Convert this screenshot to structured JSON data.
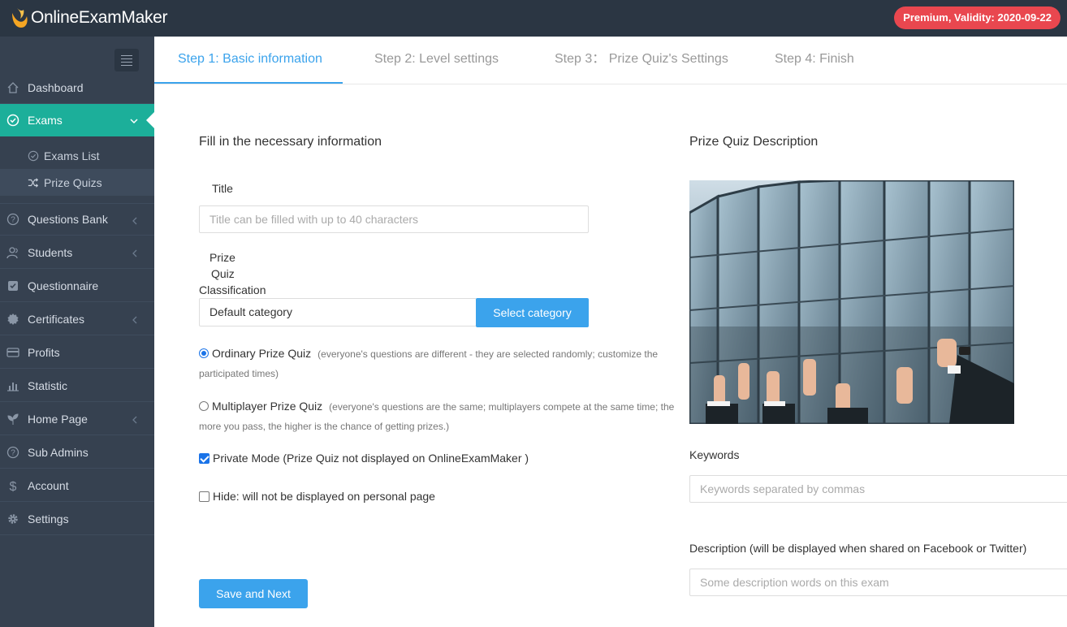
{
  "app": {
    "logo_text": "OnlineExamMaker",
    "premium_badge": "Premium, Validity: 2020-09-22"
  },
  "sidebar": {
    "items": [
      {
        "label": "Dashboard",
        "icon": "home-icon"
      },
      {
        "label": "Exams",
        "icon": "check-circle-icon"
      },
      {
        "label": "Questions Bank",
        "icon": "question-circle-icon"
      },
      {
        "label": "Students",
        "icon": "users-icon"
      },
      {
        "label": "Questionnaire",
        "icon": "checkbox-icon"
      },
      {
        "label": "Certificates",
        "icon": "badge-icon"
      },
      {
        "label": "Profits",
        "icon": "credit-card-icon"
      },
      {
        "label": "Statistic",
        "icon": "bar-chart-icon"
      },
      {
        "label": "Home Page",
        "icon": "leaf-icon"
      },
      {
        "label": "Sub Admins",
        "icon": "question-circle-icon"
      },
      {
        "label": "Account",
        "icon": "dollar-icon"
      },
      {
        "label": "Settings",
        "icon": "gear-icon"
      }
    ],
    "sub_items": [
      {
        "label": "Exams List",
        "icon": "check-circle-icon"
      },
      {
        "label": "Prize Quizs",
        "icon": "shuffle-icon"
      }
    ]
  },
  "tabs": [
    {
      "label": "Step 1: Basic information"
    },
    {
      "label": "Step 2: Level settings"
    },
    {
      "label": "Step 3： Prize Quiz's Settings"
    },
    {
      "label": "Step 4: Finish"
    }
  ],
  "form": {
    "heading": "Fill in the necessary information",
    "title_label": "Title",
    "title_placeholder": "Title can be filled with up to 40 characters",
    "classification_label_1": "Prize",
    "classification_label_2": "Quiz",
    "classification_label_3": "Classification",
    "classification_value": "Default category",
    "select_category_button": "Select category",
    "ordinary_label": "Ordinary Prize Quiz",
    "ordinary_note_1": "(everyone's questions are different - they are selected randomly; customize the",
    "ordinary_note_2": "participated times)",
    "multiplayer_label": "Multiplayer Prize Quiz",
    "multiplayer_note_1": "(everyone's questions are the same; multiplayers compete at the same time; the",
    "multiplayer_note_2": "more you pass, the higher is the chance of getting prizes.)",
    "private_mode_label": "Private Mode (Prize Quiz not displayed on OnlineExamMaker )",
    "hide_label": "Hide: will not be displayed on personal page",
    "save_next_button": "Save and Next"
  },
  "description_panel": {
    "heading": "Prize Quiz Description",
    "keywords_label": "Keywords",
    "keywords_placeholder": "Keywords separated by commas",
    "description_label": "Description (will be displayed when shared on Facebook or Twitter)",
    "description_placeholder": "Some description words on this exam"
  },
  "colors": {
    "accent": "#3ba3ec",
    "active_nav": "#1caf9a",
    "sidebar": "#364150",
    "topbar": "#2b3643",
    "badge": "#e9474f"
  }
}
